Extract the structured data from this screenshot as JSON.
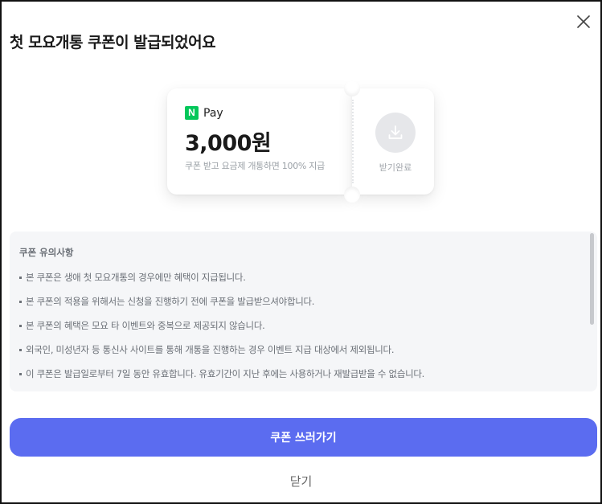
{
  "dialog": {
    "title": "첫 모요개통 쿠폰이 발급되었어요"
  },
  "coupon": {
    "brand_logo": "N",
    "brand_name": "Pay",
    "amount": "3,000원",
    "description": "쿠폰 받고 요금제 개통하면 100% 지급",
    "download_label": "받기완료",
    "brand_color": "#03c75a"
  },
  "notice": {
    "title": "쿠폰 유의사항",
    "items": [
      "본 쿠폰은 생애 첫 모요개통의 경우에만 혜택이 지급됩니다.",
      "본 쿠폰의 적용을 위해서는 신청을 진행하기 전에 쿠폰을 발급받으셔야합니다.",
      "본 쿠폰의 혜택은 모요 타 이벤트와 중복으로 제공되지 않습니다.",
      "외국인, 미성년자 등 통신사 사이트를 통해 개통을 진행하는 경우 이벤트 지급 대상에서 제외됩니다.",
      "이 쿠폰은 발급일로부터 7일 동안 유효합니다. 유효기간이 지난 후에는 사용하거나 재발급받을 수 없습니다."
    ]
  },
  "actions": {
    "primary_label": "쿠폰 쓰러가기",
    "secondary_label": "닫기",
    "accent_color": "#5b6cf0"
  },
  "icons": {
    "close": "close-icon",
    "download": "download-icon"
  }
}
